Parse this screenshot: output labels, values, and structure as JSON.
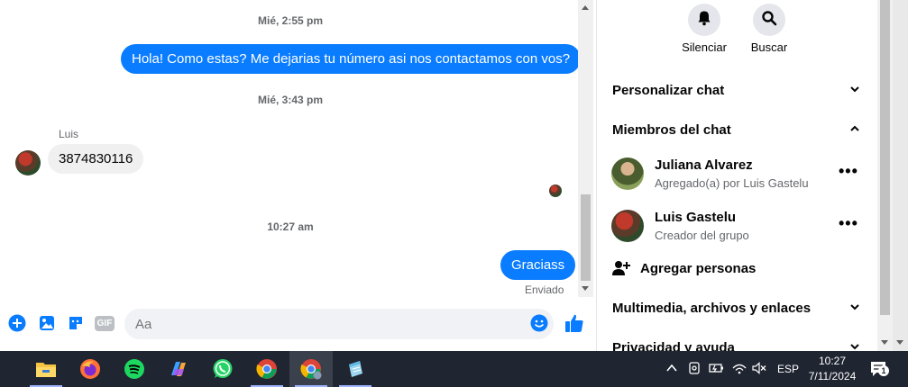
{
  "chat": {
    "timestamps": [
      "Mié, 2:55 pm",
      "Mié, 3:43 pm",
      "10:27 am"
    ],
    "messages": {
      "out1": "Hola! Como estas? Me dejarias tu número asi nos contactamos con vos?",
      "sender_luis": "Luis",
      "in1": "3874830116",
      "out2": "Graciass",
      "status": "Enviado"
    },
    "composer": {
      "placeholder": "Aa",
      "gif_label": "GIF"
    }
  },
  "info_panel": {
    "actions": {
      "mute": "Silenciar",
      "search": "Buscar"
    },
    "sections": {
      "customize": "Personalizar chat",
      "members": "Miembros del chat",
      "media": "Multimedia, archivos y enlaces",
      "privacy": "Privacidad y ayuda"
    },
    "members": [
      {
        "name": "Juliana Alvarez",
        "sub": "Agregado(a) por Luis Gastelu"
      },
      {
        "name": "Luis Gastelu",
        "sub": "Creador del grupo"
      }
    ],
    "add_people": "Agregar personas"
  },
  "taskbar": {
    "lang": "ESP",
    "time": "10:27",
    "date": "7/11/2024",
    "notif_count": "1"
  },
  "colors": {
    "messenger_blue": "#0a7cff",
    "bubble_in": "#f0f0f0",
    "taskbar": "#1f2531"
  }
}
